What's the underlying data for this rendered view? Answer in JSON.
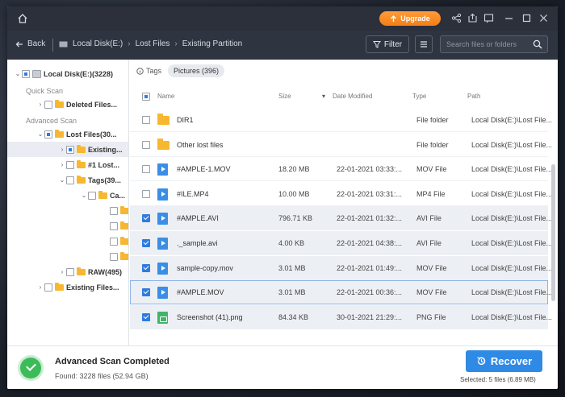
{
  "titlebar": {
    "upgrade_label": "Upgrade"
  },
  "navbar": {
    "back_label": "Back",
    "breadcrumbs": [
      "Local Disk(E:)",
      "Lost Files",
      "Existing Partition"
    ],
    "filter_label": "Filter",
    "search_placeholder": "Search files or folders"
  },
  "sidebar": {
    "drive": "Local Disk(E:)(3228)",
    "quick_scan_label": "Quick Scan",
    "deleted_files": "Deleted Files...",
    "advanced_scan_label": "Advanced Scan",
    "lost_files": "Lost Files(30...",
    "existing": "Existing...",
    "lost_sub": "#1 Lost...",
    "tags": "Tags(39...",
    "ca": "Ca...",
    "raw": "RAW(495)",
    "existing_files": "Existing Files..."
  },
  "main": {
    "tags_label": "Tags",
    "tags_chip": "Pictures (396)",
    "columns": {
      "name": "Name",
      "size": "Size",
      "date": "Date Modified",
      "type": "Type",
      "path": "Path"
    },
    "rows": [
      {
        "name": "DIR1",
        "size": "",
        "date": "",
        "type": "File folder",
        "path": "Local Disk(E:)\\Lost File...",
        "icon": "folder-icon",
        "checked": false
      },
      {
        "name": "Other lost files",
        "size": "",
        "date": "",
        "type": "File folder",
        "path": "Local Disk(E:)\\Lost File...",
        "icon": "folder-icon",
        "checked": false
      },
      {
        "name": "#AMPLE-1.MOV",
        "size": "18.20 MB",
        "date": "22-01-2021 03:33:...",
        "type": "MOV File",
        "path": "Local Disk(E:)\\Lost File...",
        "icon": "video-file-icon",
        "checked": false
      },
      {
        "name": "#ILE.MP4",
        "size": "10.00 MB",
        "date": "22-01-2021 03:31:...",
        "type": "MP4 File",
        "path": "Local Disk(E:)\\Lost File...",
        "icon": "video-file-icon",
        "checked": false
      },
      {
        "name": "#AMPLE.AVI",
        "size": "796.71 KB",
        "date": "22-01-2021 01:32:...",
        "type": "AVI File",
        "path": "Local Disk(E:)\\Lost File...",
        "icon": "video-file-icon",
        "checked": true
      },
      {
        "name": "._sample.avi",
        "size": "4.00 KB",
        "date": "22-01-2021 04:38:...",
        "type": "AVI File",
        "path": "Local Disk(E:)\\Lost File...",
        "icon": "video-file-icon",
        "checked": true
      },
      {
        "name": "sample-copy.mov",
        "size": "3.01 MB",
        "date": "22-01-2021 01:49:...",
        "type": "MOV File",
        "path": "Local Disk(E:)\\Lost File...",
        "icon": "video-file-icon",
        "checked": true
      },
      {
        "name": "#AMPLE.MOV",
        "size": "3.01 MB",
        "date": "22-01-2021 00:36:...",
        "type": "MOV File",
        "path": "Local Disk(E:)\\Lost File...",
        "icon": "video-file-icon",
        "checked": true
      },
      {
        "name": "Screenshot (41).png",
        "size": "84.34 KB",
        "date": "30-01-2021 21:29:...",
        "type": "PNG File",
        "path": "Local Disk(E:)\\Lost File...",
        "icon": "image-file-icon",
        "checked": true
      }
    ]
  },
  "footer": {
    "status_title": "Advanced Scan Completed",
    "found": "Found: 3228 files (52.94 GB)",
    "recover_label": "Recover",
    "selected": "Selected: 5 files (6.89 MB)"
  },
  "colors": {
    "accent": "#2f8ae6",
    "upgrade": "#f57e14",
    "success": "#3dbb59",
    "titlebar": "#2b303b"
  }
}
